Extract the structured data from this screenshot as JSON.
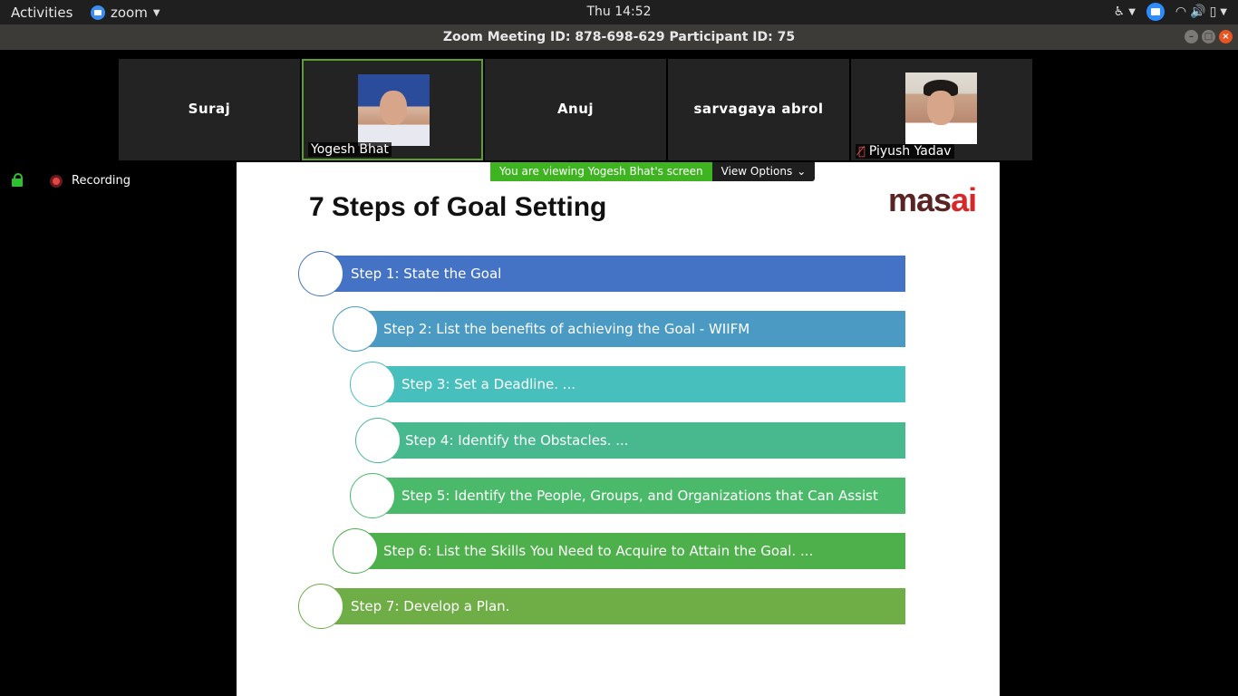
{
  "topbar": {
    "activities": "Activities",
    "app_name": "zoom",
    "clock": "Thu 14:52"
  },
  "window": {
    "title": "Zoom Meeting ID: 878-698-629 Participant ID: 75"
  },
  "participants": [
    {
      "name": "Suraj",
      "video": false
    },
    {
      "name": "Yogesh Bhat",
      "video": true,
      "active": true
    },
    {
      "name": "Anuj",
      "video": false
    },
    {
      "name": "sarvagaya abrol",
      "video": false
    },
    {
      "name": "Piyush Yadav",
      "video": true,
      "muted": true
    }
  ],
  "recording": {
    "label": "Recording"
  },
  "banner": {
    "viewing": "You are viewing Yogesh Bhat's screen",
    "view_options": "View Options"
  },
  "slide": {
    "title": "7 Steps of Goal Setting",
    "brand_part1": "mas",
    "brand_part2": "ai",
    "steps": [
      {
        "text": "Step 1: State the Goal",
        "color": "#4472c4"
      },
      {
        "text": "Step 2: List the benefits of achieving the Goal - WIIFM",
        "color": "#4a9ac4"
      },
      {
        "text": "Step 3: Set a Deadline. ...",
        "color": "#47bfbd"
      },
      {
        "text": "Step 4: Identify the Obstacles. ...",
        "color": "#48b98f"
      },
      {
        "text": "Step 5: Identify the People, Groups, and Organizations that Can Assist",
        "color": "#4aba6a"
      },
      {
        "text": "Step 6: List the Skills You Need to Acquire to Attain the Goal. ...",
        "color": "#4db04a"
      },
      {
        "text": "Step 7: Develop a Plan.",
        "color": "#6fad47"
      }
    ]
  }
}
